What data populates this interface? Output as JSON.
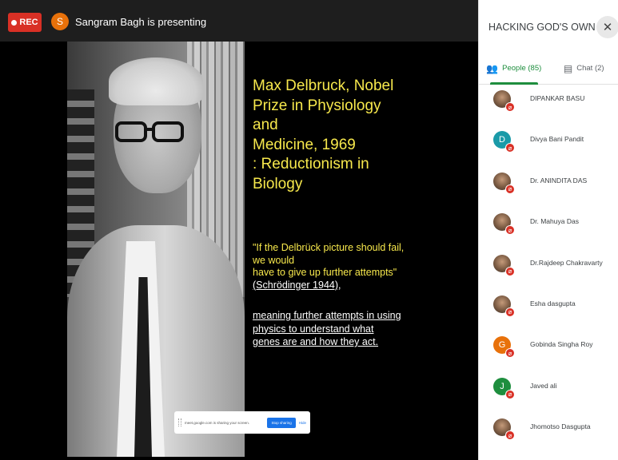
{
  "topbar": {
    "rec_label": "REC",
    "presenter_initial": "S",
    "presenter_text": "Sangram Bagh is presenting"
  },
  "slide": {
    "title_lines": [
      "Max Delbruck, Nobel",
      "Prize in Physiology and",
      "Medicine, 1969",
      ": Reductionism in",
      "Biology"
    ],
    "quote_lines": [
      "\"If the Delbrück picture should fail,",
      "we would",
      " have to give up further attempts\""
    ],
    "quote_cite": "(Schrödinger 1944),",
    "meaning_lines": [
      "meaning further attempts in using",
      "physics to understand what",
      "genes are and how they act."
    ]
  },
  "share_bar": {
    "message": "meet.google.com is sharing your screen.",
    "stop_label": "Stop sharing",
    "hide_label": "Hide"
  },
  "panel": {
    "title": "HACKING GOD'S OWN PRO...",
    "close_icon": "close-icon",
    "tabs": [
      {
        "label": "People (85)",
        "icon": "people-icon",
        "active": true
      },
      {
        "label": "Chat (2)",
        "icon": "chat-icon",
        "active": false
      }
    ],
    "people": [
      {
        "name": "DIPANKAR BASU",
        "avatar": "photo",
        "initial": ""
      },
      {
        "name": "Divya Bani Pandit",
        "avatar": "letter",
        "initial": "D",
        "color": "#1a9aa8"
      },
      {
        "name": "Dr. ANINDITA DAS",
        "avatar": "photo",
        "initial": ""
      },
      {
        "name": "Dr. Mahuya Das",
        "avatar": "photo",
        "initial": ""
      },
      {
        "name": "Dr.Rajdeep Chakravarty",
        "avatar": "photo",
        "initial": ""
      },
      {
        "name": "Esha dasgupta",
        "avatar": "photo",
        "initial": ""
      },
      {
        "name": "Gobinda Singha Roy",
        "avatar": "letter",
        "initial": "G",
        "color": "#e8710a"
      },
      {
        "name": "Javed ali",
        "avatar": "letter",
        "initial": "J",
        "color": "#1e8e3e"
      },
      {
        "name": "Jhomotso Dasgupta",
        "avatar": "photo",
        "initial": ""
      }
    ]
  }
}
